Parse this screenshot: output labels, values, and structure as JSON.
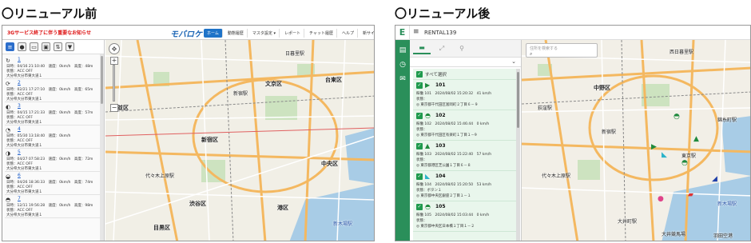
{
  "headings": {
    "before": "〇リニューアル前",
    "after": "〇リニューアル後"
  },
  "before": {
    "notice": "3Gサービス終了に伴う重要なお知らせ",
    "logo": "モバロケ",
    "nav": [
      "ホーム",
      "動態履歴",
      "マスタ設定 ▾",
      "レポート",
      "チャット履歴",
      "ヘルプ",
      "新サイト(β版)"
    ],
    "tools": [
      "list-icon",
      "user-icon",
      "car-icon",
      "window-icon",
      "sort-icon",
      "filter-icon"
    ],
    "items": [
      {
        "icon": "↻",
        "num": "1",
        "l1": "日時：04/16 21:10:40　速度：0km/h　高度：48m",
        "l2": "状態：ACC OFF",
        "l3": "大分県大分市東大道１"
      },
      {
        "icon": "⟳",
        "num": "2",
        "l1": "日時：02/21 17:27:10　速度：0km/h　高度：65m",
        "l2": "状態：ACC OFF",
        "l3": "大分県大分市東大道１"
      },
      {
        "icon": "◐",
        "num": "3",
        "l1": "日時：04/15 17:21:33　速度：0km/h　高度：57m",
        "l2": "状態：ACC OFF",
        "l3": "大分県大分市東大道１"
      },
      {
        "icon": "◔",
        "num": "4",
        "l1": "日時：05/30 13:18:40　速度：0km/h",
        "l2": "状態：ACC OFF",
        "l3": "大分県大分市東大道１"
      },
      {
        "icon": "◑",
        "num": "5",
        "l1": "日時：04/27 07:58:23　速度：0km/h　高度：72m",
        "l2": "状態：ACC OFF",
        "l3": "大分県大分市東大道１"
      },
      {
        "icon": "◒",
        "num": "6",
        "l1": "日時：04/26 18:36:33　速度：0km/h　高度：74m",
        "l2": "状態：ACC OFF",
        "l3": "大分県大分市東大道１"
      },
      {
        "icon": "◓",
        "num": "7",
        "l1": "日時：12/11 19:56:28　速度：0km/h　高度：98m",
        "l2": "状態：ACC OFF",
        "l3": "大分県大分市東大道１"
      }
    ],
    "map_labels": [
      {
        "text": "新宿区",
        "big": true
      },
      {
        "text": "新宿駅",
        "big": false
      },
      {
        "text": "代々木上原駅",
        "big": false
      },
      {
        "text": "渋谷区",
        "big": true
      },
      {
        "text": "港区",
        "big": true
      },
      {
        "text": "中央区",
        "big": true
      },
      {
        "text": "日暮里駅",
        "big": false
      },
      {
        "text": "文京区",
        "big": true
      },
      {
        "text": "目黒区",
        "big": true
      },
      {
        "text": "杉並区",
        "big": true
      },
      {
        "text": "新木場駅",
        "big": false
      },
      {
        "text": "台東区",
        "big": true
      }
    ]
  },
  "after": {
    "title": "RENTAL139",
    "rail_logo": "E",
    "tabs": [
      "car-icon",
      "route-icon",
      "pin-icon"
    ],
    "search_placeholder": "住所を検索する",
    "select_all": "すべて選択",
    "vehicles": [
      {
        "name": "101",
        "icon": "▶",
        "color": "#1f8a3d",
        "d1": "稼働 101　2024/08/02 15:20:32　41 km/h",
        "d2": "状態：",
        "d3": "◎ 東京都千代田区富岡町２丁目６－９"
      },
      {
        "name": "102",
        "icon": "◓",
        "color": "#1f8a3d",
        "d1": "稼働 102　2024/08/02 15:46:44　0 km/h",
        "d2": "状態：",
        "d3": "◎ 東京都千代田区有楽町１丁目１－9"
      },
      {
        "name": "103",
        "icon": "▲",
        "color": "#1f8a3d",
        "d1": "稼働 103　2024/08/02 15:22:40　57 km/h",
        "d2": "状態：",
        "d3": "◎ 東京都港区芝公園１丁目６－８"
      },
      {
        "name": "104",
        "icon": "◣",
        "color": "#2bb3c9",
        "d1": "稼働 104　2024/08/02 15:20:50　53 km/h",
        "d2": "状態：ボタン１",
        "d3": "◎ 東京都中央区銀座２丁目１－１"
      },
      {
        "name": "105",
        "icon": "◓",
        "color": "#1f8a3d",
        "d1": "稼働 105　2024/08/02 15:03:44　0 km/h",
        "d2": "状態：",
        "d3": "◎ 東京都中央区日本橋１丁目１－２"
      }
    ],
    "map_labels": [
      {
        "text": "西日暮里駅",
        "big": false
      },
      {
        "text": "錦糸町駅",
        "big": false
      },
      {
        "text": "中野区",
        "big": true
      },
      {
        "text": "荻窪駅",
        "big": false
      },
      {
        "text": "新宿駅",
        "big": false
      },
      {
        "text": "代々木上原駅",
        "big": false
      },
      {
        "text": "東京駅",
        "big": false
      },
      {
        "text": "新木場駅",
        "big": false
      },
      {
        "text": "大井町駅",
        "big": false
      },
      {
        "text": "大井競馬場",
        "big": false
      },
      {
        "text": "羽田空港",
        "big": false
      }
    ]
  },
  "colors": {
    "accent_blue": "#1e73c8",
    "accent_green": "#2a8f5a",
    "list_bg": "#e9f6ec",
    "notice_red": "#dd1111"
  }
}
